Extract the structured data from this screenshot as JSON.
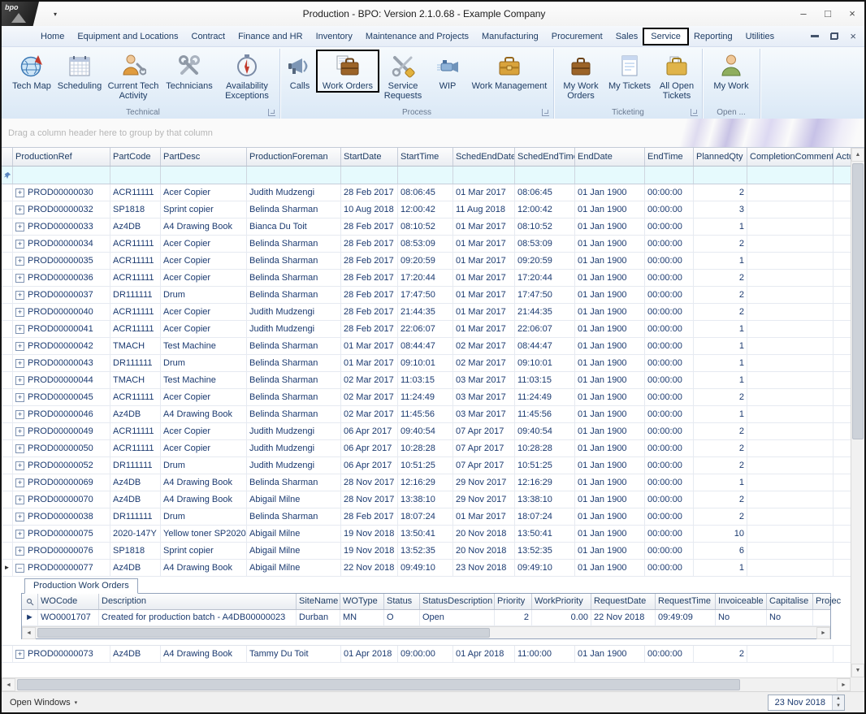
{
  "window": {
    "title": "Production - BPO: Version 2.1.0.68 - Example Company",
    "logo_text": "bpo"
  },
  "glyphs": {
    "qat_dropdown": "▾",
    "minimize": "–",
    "maximize": "□",
    "close": "×",
    "dropdown_small": "▾",
    "scroll_up": "▲",
    "scroll_down": "▼",
    "scroll_left": "◄",
    "scroll_right": "►",
    "row_marker": "►",
    "expand": "+",
    "collapse": "–",
    "spin_up": "▲",
    "spin_down": "▼"
  },
  "colors": {
    "grid_text": "#1b3a70",
    "filter_row_bg": "#e6fafd",
    "annotation_outline": "#000000"
  },
  "menu": {
    "tabs": [
      {
        "label": "Home"
      },
      {
        "label": "Equipment and Locations"
      },
      {
        "label": "Contract"
      },
      {
        "label": "Finance and HR"
      },
      {
        "label": "Inventory"
      },
      {
        "label": "Maintenance and Projects"
      },
      {
        "label": "Manufacturing"
      },
      {
        "label": "Procurement"
      },
      {
        "label": "Sales"
      },
      {
        "label": "Service",
        "highlighted": true
      },
      {
        "label": "Reporting"
      },
      {
        "label": "Utilities"
      }
    ]
  },
  "ribbon": {
    "groups": [
      {
        "label": "Technical",
        "has_launcher": true,
        "items": [
          {
            "label": "Tech Map",
            "icon": "tech-map-icon"
          },
          {
            "label": "Scheduling",
            "icon": "scheduling-icon"
          },
          {
            "label": "Current Tech Activity",
            "icon": "current-tech-activity-icon"
          },
          {
            "label": "Technicians",
            "icon": "technicians-icon"
          },
          {
            "label": "Availability Exceptions",
            "icon": "availability-exceptions-icon"
          }
        ]
      },
      {
        "label": "Process",
        "has_launcher": true,
        "items": [
          {
            "label": "Calls",
            "icon": "calls-icon"
          },
          {
            "label": "Work Orders",
            "icon": "work-orders-icon",
            "highlighted": true
          },
          {
            "label": "Service Requests",
            "icon": "service-requests-icon"
          },
          {
            "label": "WIP",
            "icon": "wip-icon"
          },
          {
            "label": "Work Management",
            "icon": "work-management-icon"
          }
        ]
      },
      {
        "label": "Ticketing",
        "has_launcher": true,
        "items": [
          {
            "label": "My Work Orders",
            "icon": "my-work-orders-icon"
          },
          {
            "label": "My Tickets",
            "icon": "my-tickets-icon"
          },
          {
            "label": "All Open Tickets",
            "icon": "all-open-tickets-icon"
          }
        ]
      },
      {
        "label": "Open ...",
        "has_launcher": false,
        "items": [
          {
            "label": "My Work",
            "icon": "my-work-icon"
          }
        ]
      }
    ]
  },
  "group_by_bar": {
    "text": "Drag a column header here to group by that column"
  },
  "grid": {
    "columns": [
      "ProductionRef",
      "PartCode",
      "PartDesc",
      "ProductionForeman",
      "StartDate",
      "StartTime",
      "SchedEndDate",
      "SchedEndTime",
      "EndDate",
      "EndTime",
      "PlannedQty",
      "CompletionComments",
      "Actu"
    ],
    "expanded_ref": "PROD00000077",
    "rows": [
      [
        "PROD00000030",
        "ACR11111",
        "Acer Copier",
        "Judith Mudzengi",
        "28 Feb 2017",
        "08:06:45",
        "01 Mar 2017",
        "08:06:45",
        "01 Jan 1900",
        "00:00:00",
        "2",
        "",
        ""
      ],
      [
        "PROD00000032",
        "SP1818",
        "Sprint copier",
        "Belinda Sharman",
        "10 Aug 2018",
        "12:00:42",
        "11 Aug 2018",
        "12:00:42",
        "01 Jan 1900",
        "00:00:00",
        "3",
        "",
        ""
      ],
      [
        "PROD00000033",
        "Az4DB",
        "A4 Drawing Book",
        "Bianca Du Toit",
        "28 Feb 2017",
        "08:10:52",
        "01 Mar 2017",
        "08:10:52",
        "01 Jan 1900",
        "00:00:00",
        "1",
        "",
        ""
      ],
      [
        "PROD00000034",
        "ACR11111",
        "Acer Copier",
        "Belinda Sharman",
        "28 Feb 2017",
        "08:53:09",
        "01 Mar 2017",
        "08:53:09",
        "01 Jan 1900",
        "00:00:00",
        "2",
        "",
        ""
      ],
      [
        "PROD00000035",
        "ACR11111",
        "Acer Copier",
        "Belinda Sharman",
        "28 Feb 2017",
        "09:20:59",
        "01 Mar 2017",
        "09:20:59",
        "01 Jan 1900",
        "00:00:00",
        "1",
        "",
        ""
      ],
      [
        "PROD00000036",
        "ACR11111",
        "Acer Copier",
        "Belinda Sharman",
        "28 Feb 2017",
        "17:20:44",
        "01 Mar 2017",
        "17:20:44",
        "01 Jan 1900",
        "00:00:00",
        "2",
        "",
        ""
      ],
      [
        "PROD00000037",
        "DR111111",
        "Drum",
        "Belinda Sharman",
        "28 Feb 2017",
        "17:47:50",
        "01 Mar 2017",
        "17:47:50",
        "01 Jan 1900",
        "00:00:00",
        "2",
        "",
        ""
      ],
      [
        "PROD00000040",
        "ACR11111",
        "Acer Copier",
        "Judith Mudzengi",
        "28 Feb 2017",
        "21:44:35",
        "01 Mar 2017",
        "21:44:35",
        "01 Jan 1900",
        "00:00:00",
        "2",
        "",
        ""
      ],
      [
        "PROD00000041",
        "ACR11111",
        "Acer Copier",
        "Judith Mudzengi",
        "28 Feb 2017",
        "22:06:07",
        "01 Mar 2017",
        "22:06:07",
        "01 Jan 1900",
        "00:00:00",
        "1",
        "",
        ""
      ],
      [
        "PROD00000042",
        "TMACH",
        "Test Machine",
        "Belinda Sharman",
        "01 Mar 2017",
        "08:44:47",
        "02 Mar 2017",
        "08:44:47",
        "01 Jan 1900",
        "00:00:00",
        "1",
        "",
        ""
      ],
      [
        "PROD00000043",
        "DR111111",
        "Drum",
        "Belinda Sharman",
        "01 Mar 2017",
        "09:10:01",
        "02 Mar 2017",
        "09:10:01",
        "01 Jan 1900",
        "00:00:00",
        "1",
        "",
        ""
      ],
      [
        "PROD00000044",
        "TMACH",
        "Test Machine",
        "Belinda Sharman",
        "02 Mar 2017",
        "11:03:15",
        "03 Mar 2017",
        "11:03:15",
        "01 Jan 1900",
        "00:00:00",
        "1",
        "",
        ""
      ],
      [
        "PROD00000045",
        "ACR11111",
        "Acer Copier",
        "Belinda Sharman",
        "02 Mar 2017",
        "11:24:49",
        "03 Mar 2017",
        "11:24:49",
        "01 Jan 1900",
        "00:00:00",
        "2",
        "",
        ""
      ],
      [
        "PROD00000046",
        "Az4DB",
        "A4 Drawing Book",
        "Belinda Sharman",
        "02 Mar 2017",
        "11:45:56",
        "03 Mar 2017",
        "11:45:56",
        "01 Jan 1900",
        "00:00:00",
        "1",
        "",
        ""
      ],
      [
        "PROD00000049",
        "ACR11111",
        "Acer Copier",
        "Judith Mudzengi",
        "06 Apr 2017",
        "09:40:54",
        "07 Apr 2017",
        "09:40:54",
        "01 Jan 1900",
        "00:00:00",
        "2",
        "",
        ""
      ],
      [
        "PROD00000050",
        "ACR11111",
        "Acer Copier",
        "Judith Mudzengi",
        "06 Apr 2017",
        "10:28:28",
        "07 Apr 2017",
        "10:28:28",
        "01 Jan 1900",
        "00:00:00",
        "2",
        "",
        ""
      ],
      [
        "PROD00000052",
        "DR111111",
        "Drum",
        "Judith Mudzengi",
        "06 Apr 2017",
        "10:51:25",
        "07 Apr 2017",
        "10:51:25",
        "01 Jan 1900",
        "00:00:00",
        "2",
        "",
        ""
      ],
      [
        "PROD00000069",
        "Az4DB",
        "A4 Drawing Book",
        "Belinda Sharman",
        "28 Nov 2017",
        "12:16:29",
        "29 Nov 2017",
        "12:16:29",
        "01 Jan 1900",
        "00:00:00",
        "1",
        "",
        ""
      ],
      [
        "PROD00000070",
        "Az4DB",
        "A4 Drawing Book",
        "Abigail Milne",
        "28 Nov 2017",
        "13:38:10",
        "29 Nov 2017",
        "13:38:10",
        "01 Jan 1900",
        "00:00:00",
        "2",
        "",
        ""
      ],
      [
        "PROD00000038",
        "DR111111",
        "Drum",
        "Belinda Sharman",
        "28 Feb 2017",
        "18:07:24",
        "01 Mar 2017",
        "18:07:24",
        "01 Jan 1900",
        "00:00:00",
        "2",
        "",
        ""
      ],
      [
        "PROD00000075",
        "2020-147Y",
        "Yellow toner SP2020",
        "Abigail Milne",
        "19 Nov 2018",
        "13:50:41",
        "20 Nov 2018",
        "13:50:41",
        "01 Jan 1900",
        "00:00:00",
        "10",
        "",
        ""
      ],
      [
        "PROD00000076",
        "SP1818",
        "Sprint copier",
        "Abigail Milne",
        "19 Nov 2018",
        "13:52:35",
        "20 Nov 2018",
        "13:52:35",
        "01 Jan 1900",
        "00:00:00",
        "6",
        "",
        ""
      ],
      [
        "PROD00000077",
        "Az4DB",
        "A4 Drawing Book",
        "Abigail Milne",
        "22 Nov 2018",
        "09:49:10",
        "23 Nov 2018",
        "09:49:10",
        "01 Jan 1900",
        "00:00:00",
        "1",
        "",
        ""
      ],
      [
        "PROD00000073",
        "Az4DB",
        "A4 Drawing Book",
        "Tammy Du Toit",
        "01 Apr 2018",
        "09:00:00",
        "01 Apr 2018",
        "11:00:00",
        "01 Jan 1900",
        "00:00:00",
        "2",
        "",
        ""
      ]
    ]
  },
  "detail": {
    "tab": "Production Work Orders",
    "columns": [
      "WOCode",
      "Description",
      "SiteName",
      "WOType",
      "Status",
      "StatusDescription",
      "Priority",
      "WorkPriority",
      "RequestDate",
      "RequestTime",
      "Invoiceable",
      "Capitalise",
      "Projec"
    ],
    "rows": [
      [
        "WO0001707",
        "Created for production batch - A4DB00000023",
        "Durban",
        "MN",
        "O",
        "Open",
        "2",
        "0.00",
        "22 Nov 2018",
        "09:49:09",
        "No",
        "No",
        ""
      ]
    ]
  },
  "status_bar": {
    "open_windows_label": "Open Windows",
    "date_value": "23 Nov 2018"
  }
}
